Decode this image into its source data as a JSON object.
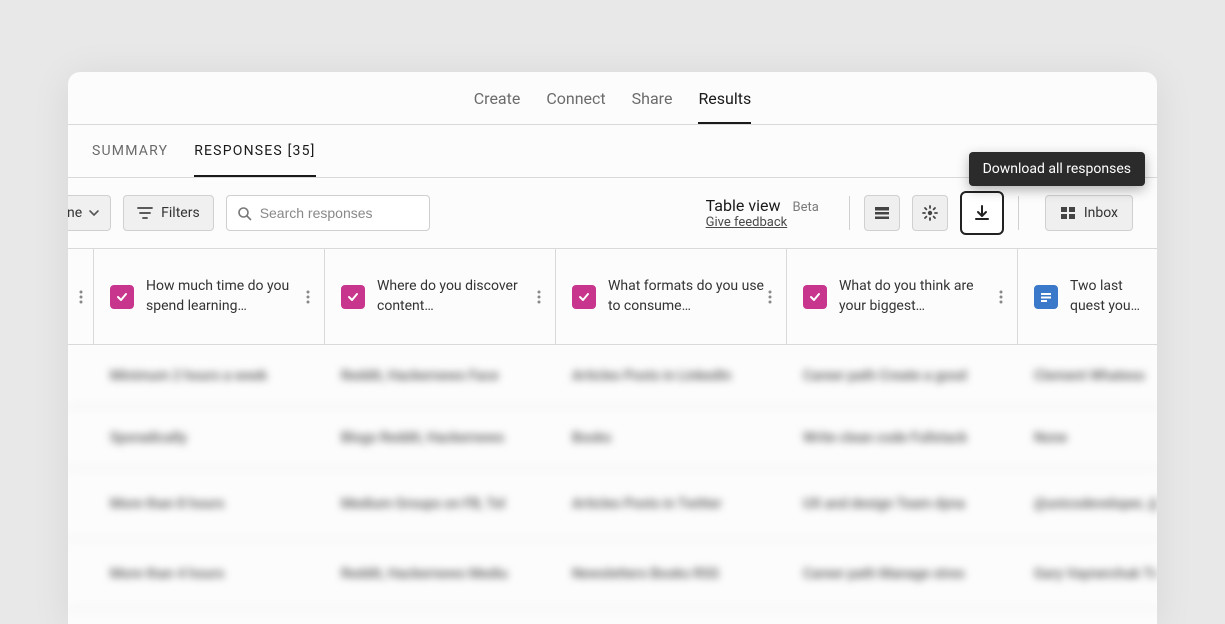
{
  "topNav": {
    "items": [
      "Create",
      "Connect",
      "Share",
      "Results"
    ],
    "activeIndex": 3
  },
  "subNav": {
    "items": [
      "SUMMARY",
      "RESPONSES [35]"
    ],
    "activeIndex": 1
  },
  "toolbar": {
    "columnDropdownSuffix": "ne",
    "filtersLabel": "Filters",
    "searchPlaceholder": "Search responses",
    "tableViewTitle": "Table view",
    "betaLabel": "Beta",
    "giveFeedback": "Give feedback",
    "inboxLabel": "Inbox"
  },
  "tooltip": "Download all responses",
  "columns": [
    {
      "type": "pink",
      "label": "How much time do you spend learning…"
    },
    {
      "type": "pink",
      "label": "Where do you discover content…"
    },
    {
      "type": "pink",
      "label": "What formats do you use to consume…"
    },
    {
      "type": "pink",
      "label": "What do you think are your biggest…"
    },
    {
      "type": "blue",
      "label": "Two last quest you follow on s"
    }
  ],
  "rows": [
    {
      "cells": [
        "Minimum 2 hours a week",
        "Reddit, Hackernews    Face",
        "Articles    Posts in LinkedIn",
        "Career path    Create a good",
        "Clement Whateso"
      ]
    },
    {
      "cells": [
        "Sporadically",
        "Blogs    Reddit, Hackernews",
        "Books",
        "Write clean code    Fullstack",
        "None"
      ]
    },
    {
      "cells": [
        "More than 8 hours",
        "Medium    Groups on FB, Tel",
        "Articles    Posts in Twitter",
        "UX and design    Team dyna",
        "@unicodeveloper, @davidkams, @elij"
      ]
    },
    {
      "cells": [
        "More than 4 hours",
        "Reddit, Hackernews    Mediu",
        "Newsletters    Books    RSS",
        "Career path    Manage stres",
        "Gary Vaynerchuk Tiago Forte"
      ]
    }
  ]
}
